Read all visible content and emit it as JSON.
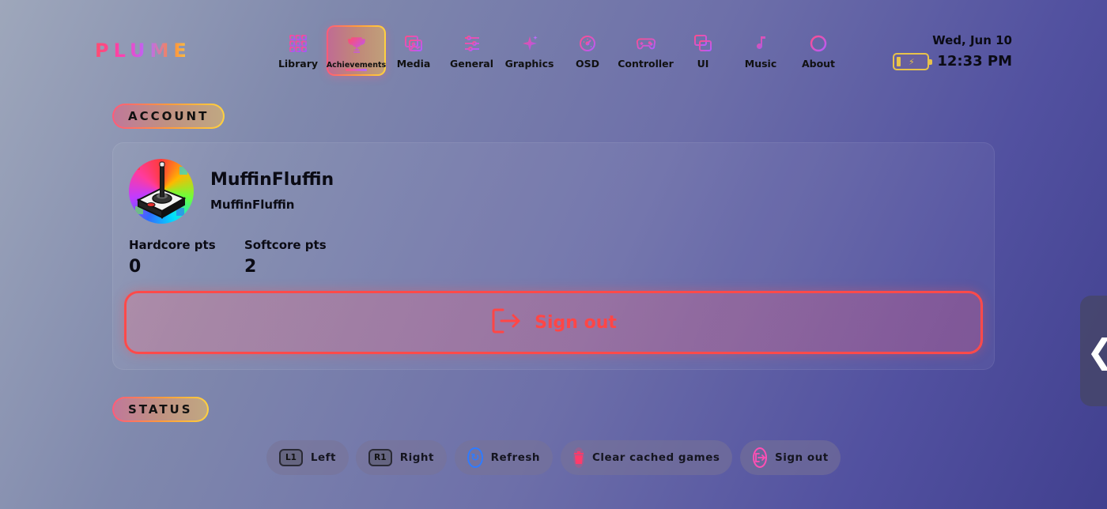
{
  "app": {
    "logo": "PLUME"
  },
  "nav": {
    "items": [
      {
        "label": "Library",
        "icon": "grid-icon"
      },
      {
        "label": "Achievements",
        "icon": "trophy-icon",
        "active": true
      },
      {
        "label": "Media",
        "icon": "media-icon"
      },
      {
        "label": "General",
        "icon": "sliders-icon"
      },
      {
        "label": "Graphics",
        "icon": "sparkle-icon"
      },
      {
        "label": "OSD",
        "icon": "gauge-icon"
      },
      {
        "label": "Controller",
        "icon": "gamepad-icon"
      },
      {
        "label": "UI",
        "icon": "windows-icon"
      },
      {
        "label": "Music",
        "icon": "music-note-icon"
      },
      {
        "label": "About",
        "icon": "info-icon"
      }
    ]
  },
  "status_bar": {
    "date": "Wed, Jun 10",
    "time": "12:33 PM",
    "battery_level": 0.15,
    "battery_charging": true
  },
  "account": {
    "section_title": "ACCOUNT",
    "display_name": "MuffinFluffin",
    "username": "MuffinFluffin",
    "hardcore_label": "Hardcore pts",
    "hardcore_value": "0",
    "softcore_label": "Softcore pts",
    "softcore_value": "2",
    "signout_label": "Sign out"
  },
  "status": {
    "section_title": "STATUS"
  },
  "hints": [
    {
      "key": "L1",
      "label": "Left"
    },
    {
      "key": "R1",
      "label": "Right"
    },
    {
      "key": "refresh-icon",
      "label": "Refresh"
    },
    {
      "key": "trash-icon",
      "label": "Clear cached games"
    },
    {
      "key": "signout-icon",
      "label": "Sign out"
    }
  ],
  "colors": {
    "accent_red": "#ff4a4a",
    "battery": "#e8c24a",
    "refresh": "#2f7bff",
    "trash": "#ff3b6b",
    "signout_hint": "#ff4fb4"
  }
}
